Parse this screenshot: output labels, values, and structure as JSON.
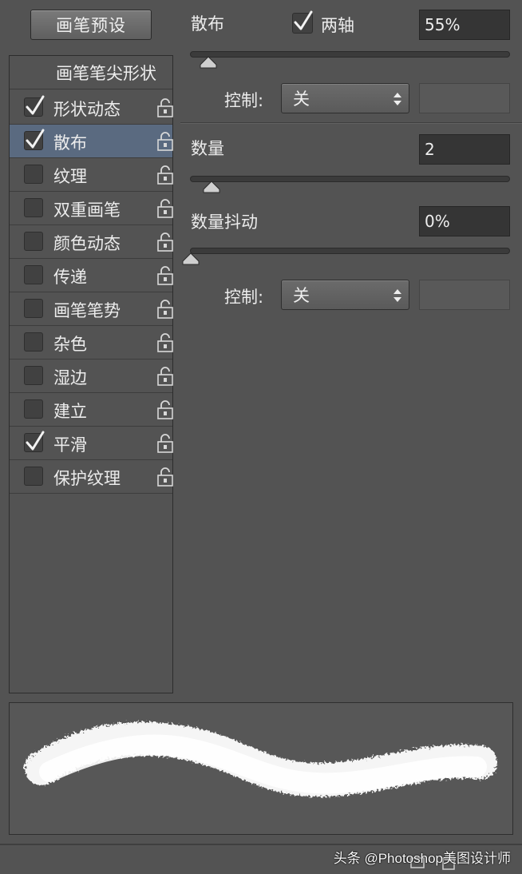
{
  "preset_button": "画笔预设",
  "tip_shape_label": "画笔笔尖形状",
  "left_list": [
    {
      "label": "形状动态",
      "checked": true,
      "selected": false
    },
    {
      "label": "散布",
      "checked": true,
      "selected": true
    },
    {
      "label": "纹理",
      "checked": false,
      "selected": false
    },
    {
      "label": "双重画笔",
      "checked": false,
      "selected": false
    },
    {
      "label": "颜色动态",
      "checked": false,
      "selected": false
    },
    {
      "label": "传递",
      "checked": false,
      "selected": false
    },
    {
      "label": "画笔笔势",
      "checked": false,
      "selected": false
    },
    {
      "label": "杂色",
      "checked": false,
      "selected": false
    },
    {
      "label": "湿边",
      "checked": false,
      "selected": false
    },
    {
      "label": "建立",
      "checked": false,
      "selected": false
    },
    {
      "label": "平滑",
      "checked": true,
      "selected": false
    },
    {
      "label": "保护纹理",
      "checked": false,
      "selected": false
    }
  ],
  "scatter": {
    "label": "散布",
    "both_axes_label": "两轴",
    "both_axes_checked": true,
    "value": "55%",
    "control_label": "控制:",
    "control_value": "关"
  },
  "count": {
    "label": "数量",
    "value": "2"
  },
  "count_jitter": {
    "label": "数量抖动",
    "value": "0%",
    "control_label": "控制:",
    "control_value": "关"
  },
  "watermark": "头条 @Photoshop美图设计师",
  "colors": {
    "panel_bg": "#535353",
    "selected_row": "#5a6a80",
    "field_bg": "#353535"
  }
}
